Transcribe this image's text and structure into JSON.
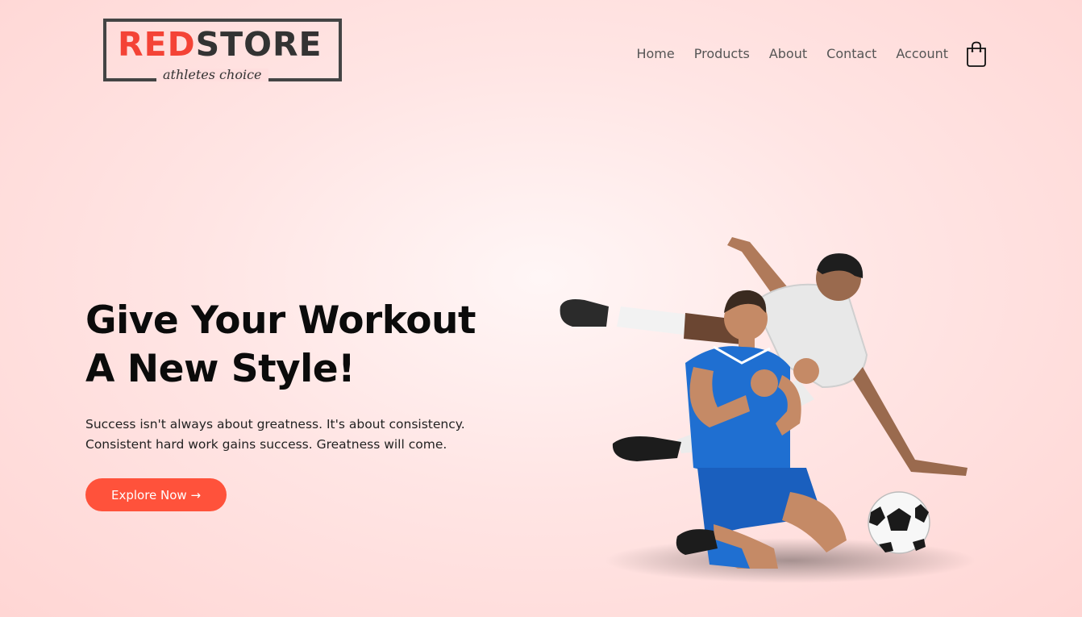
{
  "brand": {
    "logo_main_red": "RED",
    "logo_main_dark": "STORE",
    "logo_tagline": "athletes choice"
  },
  "nav": {
    "items": [
      "Home",
      "Products",
      "About",
      "Contact",
      "Account"
    ],
    "cart_icon": "shopping-bag-icon"
  },
  "hero": {
    "title_line1": "Give Your Workout",
    "title_line2": "A New Style!",
    "text_line1": "Success isn't always about greatness. It's about consistency.",
    "text_line2": "Consistent hard work gains success. Greatness will come.",
    "button_label": "Explore Now →"
  },
  "colors": {
    "accent": "#ff523b",
    "logo_red": "#f44336",
    "background": "#ffe5e4"
  }
}
